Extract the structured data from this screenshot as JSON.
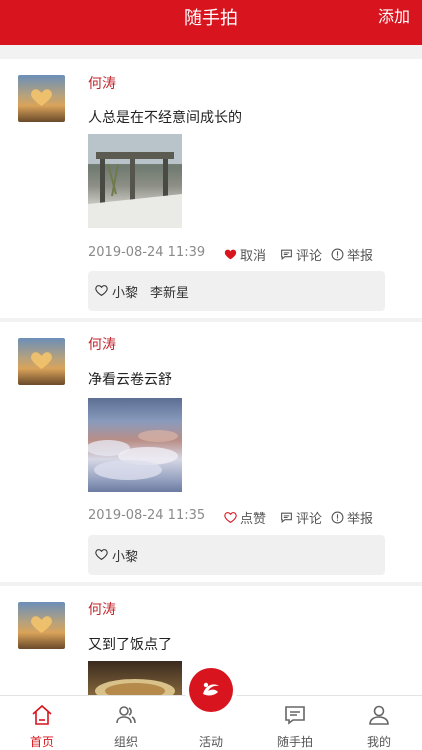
{
  "header": {
    "title": "随手拍",
    "add_label": "添加"
  },
  "posts": [
    {
      "author": "何涛",
      "text": "人总是在不经意间成长的",
      "time": "2019-08-24 11:39",
      "like_label": "取消",
      "liked": true,
      "comment_label": "评论",
      "report_label": "举报",
      "likers": [
        "小黎",
        "李新星"
      ],
      "photo": "pavilion-photo"
    },
    {
      "author": "何涛",
      "text": "净看云卷云舒",
      "time": "2019-08-24 11:35",
      "like_label": "点赞",
      "liked": false,
      "comment_label": "评论",
      "report_label": "举报",
      "likers": [
        "小黎"
      ],
      "photo": "clouds-photo"
    },
    {
      "author": "何涛",
      "text": "又到了饭点了",
      "photo": "food-photo"
    }
  ],
  "tabs": [
    {
      "label": "首页",
      "icon": "home-icon",
      "active": true
    },
    {
      "label": "组织",
      "icon": "people-icon",
      "active": false
    },
    {
      "label": "活动",
      "icon": "logo-badge",
      "active": false
    },
    {
      "label": "随手拍",
      "icon": "message-icon",
      "active": false
    },
    {
      "label": "我的",
      "icon": "user-icon",
      "active": false
    }
  ],
  "colors": {
    "accent": "#d8141e",
    "author": "#c0262e"
  }
}
